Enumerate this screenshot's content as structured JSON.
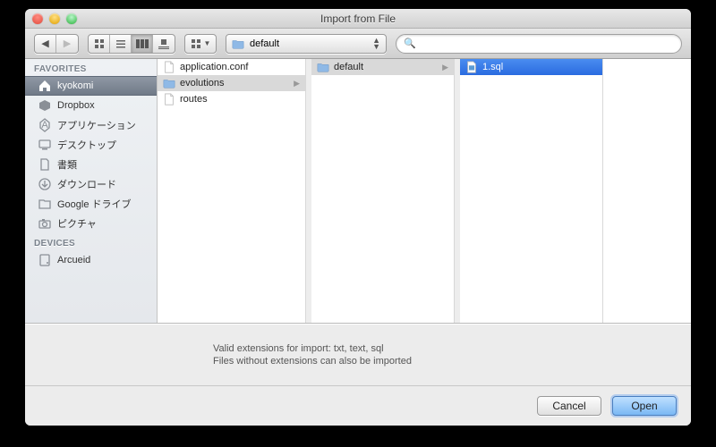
{
  "window": {
    "title": "Import from File"
  },
  "toolbar": {
    "path_label": "default",
    "search_placeholder": ""
  },
  "sidebar": {
    "section_favorites": "FAVORITES",
    "section_devices": "DEVICES",
    "favorites": [
      {
        "label": "kyokomi",
        "icon": "home-icon",
        "selected": true
      },
      {
        "label": "Dropbox",
        "icon": "box-icon"
      },
      {
        "label": "アプリケーション",
        "icon": "app-icon"
      },
      {
        "label": "デスクトップ",
        "icon": "desktop-icon"
      },
      {
        "label": "書類",
        "icon": "doc-icon"
      },
      {
        "label": "ダウンロード",
        "icon": "download-icon"
      },
      {
        "label": "Google ドライブ",
        "icon": "folder-icon"
      },
      {
        "label": "ピクチャ",
        "icon": "camera-icon"
      }
    ],
    "devices": [
      {
        "label": "Arcueid",
        "icon": "disk-icon"
      }
    ]
  },
  "columns": [
    {
      "items": [
        {
          "label": "application.conf",
          "type": "file"
        },
        {
          "label": "evolutions",
          "type": "folder",
          "selected": "path"
        },
        {
          "label": "routes",
          "type": "file"
        }
      ]
    },
    {
      "items": [
        {
          "label": "default",
          "type": "folder",
          "selected": "path"
        }
      ]
    },
    {
      "items": [
        {
          "label": "1.sql",
          "type": "file",
          "selected": "active"
        }
      ]
    }
  ],
  "hint": {
    "line1": "Valid extensions for import: txt, text, sql",
    "line2": "Files without extensions can also be imported"
  },
  "buttons": {
    "cancel": "Cancel",
    "open": "Open"
  }
}
